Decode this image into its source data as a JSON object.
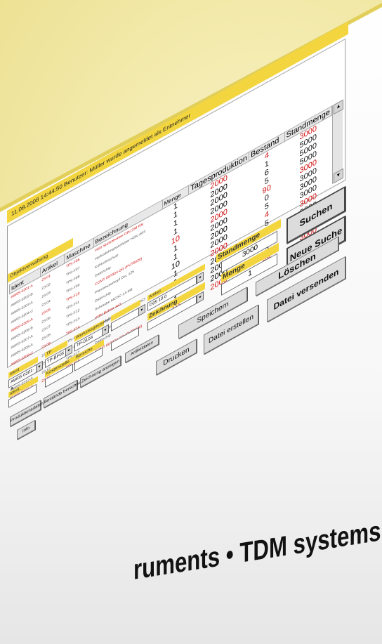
{
  "statusbar": {
    "text": "11.08.2008 14:44:50   Benutzer: Müller wurde angemeldet als Entnehmer"
  },
  "panel": {
    "title": "Objektverwaltung"
  },
  "table": {
    "columns": [
      "Ident",
      "Artikel",
      "Maschine",
      "Bezeichnung",
      "Menge",
      "Tagesproduktion",
      "Bestand",
      "Standmenge"
    ],
    "rows": [
      [
        "AW05-0201-A",
        "23.01",
        "TP5-F06",
        "HSS Stufenbohrer DIN 338 RN",
        "1",
        "2000",
        "4",
        "3000"
      ],
      [
        "AW05-0202-B",
        "23.02",
        "TP5-F07",
        "Hydrodehnspannfutter HSK-A63",
        "1",
        "2000",
        "1",
        "5000"
      ],
      [
        "AW05-0203-A",
        "23.03",
        "TP5-F08",
        "Kühlrohrschutz",
        "1",
        "2000",
        "6",
        "5000"
      ],
      [
        "AW05-0204-C",
        "23.04",
        "TP5-F09",
        "Datenchip",
        "1",
        "2000",
        "5",
        "5000"
      ],
      [
        "AW05-0205-A",
        "23.05",
        "TP5-F10",
        "CCMT 09T304 GR (PVT0020)",
        "10",
        "2000",
        "90",
        "3000"
      ],
      [
        "AW05-0206-B",
        "23.06",
        "TP5-F11",
        "Planmesserkopf Dia. 125",
        "1",
        "2000",
        "0",
        "3000"
      ],
      [
        "AW05-0207-A",
        "23.07",
        "TP5-F12",
        "Datenchip",
        "1",
        "2000",
        "5",
        "3000"
      ],
      [
        "AW05-0208-A",
        "23.08",
        "TP5-F13",
        "Schraube MCSC-14-M6",
        "10",
        "2000",
        "4",
        "3000"
      ],
      [
        "AW05-0209-C",
        "23.09",
        "TP5-F14",
        "VHM Bohrer 4x0",
        "1",
        "2000",
        "5",
        "3000"
      ],
      [
        "AW05-0210-A",
        "23.10",
        "TP5-F15",
        "Hydrodehnspannfutter HSK-A63",
        "1",
        "2000",
        "1",
        "3000"
      ],
      [
        "AW05-0211-B",
        "23.11",
        "TP5-F16",
        "Kühlrohrschutz",
        "1",
        "2000",
        "6",
        "3000"
      ],
      [
        "AW05-0212-A",
        "23.12",
        "TP5-F17",
        "Datenchip",
        "1",
        "2000",
        "5",
        "3000"
      ],
      [
        "AW05-0213-C",
        "23.13",
        "TP5-F18",
        "CCMT 09T304 GR (PVT0020)",
        "10",
        "2000",
        "90",
        "3000"
      ]
    ],
    "red_rows": [
      0,
      4,
      8,
      12
    ],
    "red_bestand": [
      0,
      4,
      7,
      12
    ],
    "red_standmenge": [
      0,
      4,
      8,
      12
    ]
  },
  "form": {
    "f1_label": "Ident",
    "f1_value": "AW05-0201-A",
    "f2_label": "TP",
    "f2_value": "TP-BF05",
    "f3_label": "Werkzeugnummer",
    "f3_value": "TP-0103",
    "f4_label": "",
    "f4_value": "",
    "artikel_label": "Artikel",
    "artikel_value": "D05 10.0",
    "standmenge_label": "Standmenge",
    "standmenge_value": "3000",
    "g1_label": "Ident. Entnahme",
    "g2_label": "Kostenstelle",
    "g3_label": "Bereiche",
    "zeichnung_label": "Zeichnung",
    "zeichnung_value": "",
    "menge_label": "Menge",
    "menge_value": "1"
  },
  "buttons": {
    "suchen": "Suchen",
    "neue_suche": "Neue Suche",
    "small1": "Produktionsdaten",
    "small2": "Bestände berechnen",
    "small3": "Zeichnung anzeigen",
    "small4": "Artikeldaten",
    "small5": "Info",
    "speichern": "Speichern",
    "loeschen": "Löschen",
    "drucken": "Drucken",
    "datei_erstellen": "Datei erstellen",
    "datei_versenden": "Datei versenden"
  },
  "banner": {
    "text": "ruments • TDM systems"
  },
  "colors": {
    "accent": "#f3d63f",
    "background": "#f2e9a8",
    "alert": "#d01010"
  }
}
